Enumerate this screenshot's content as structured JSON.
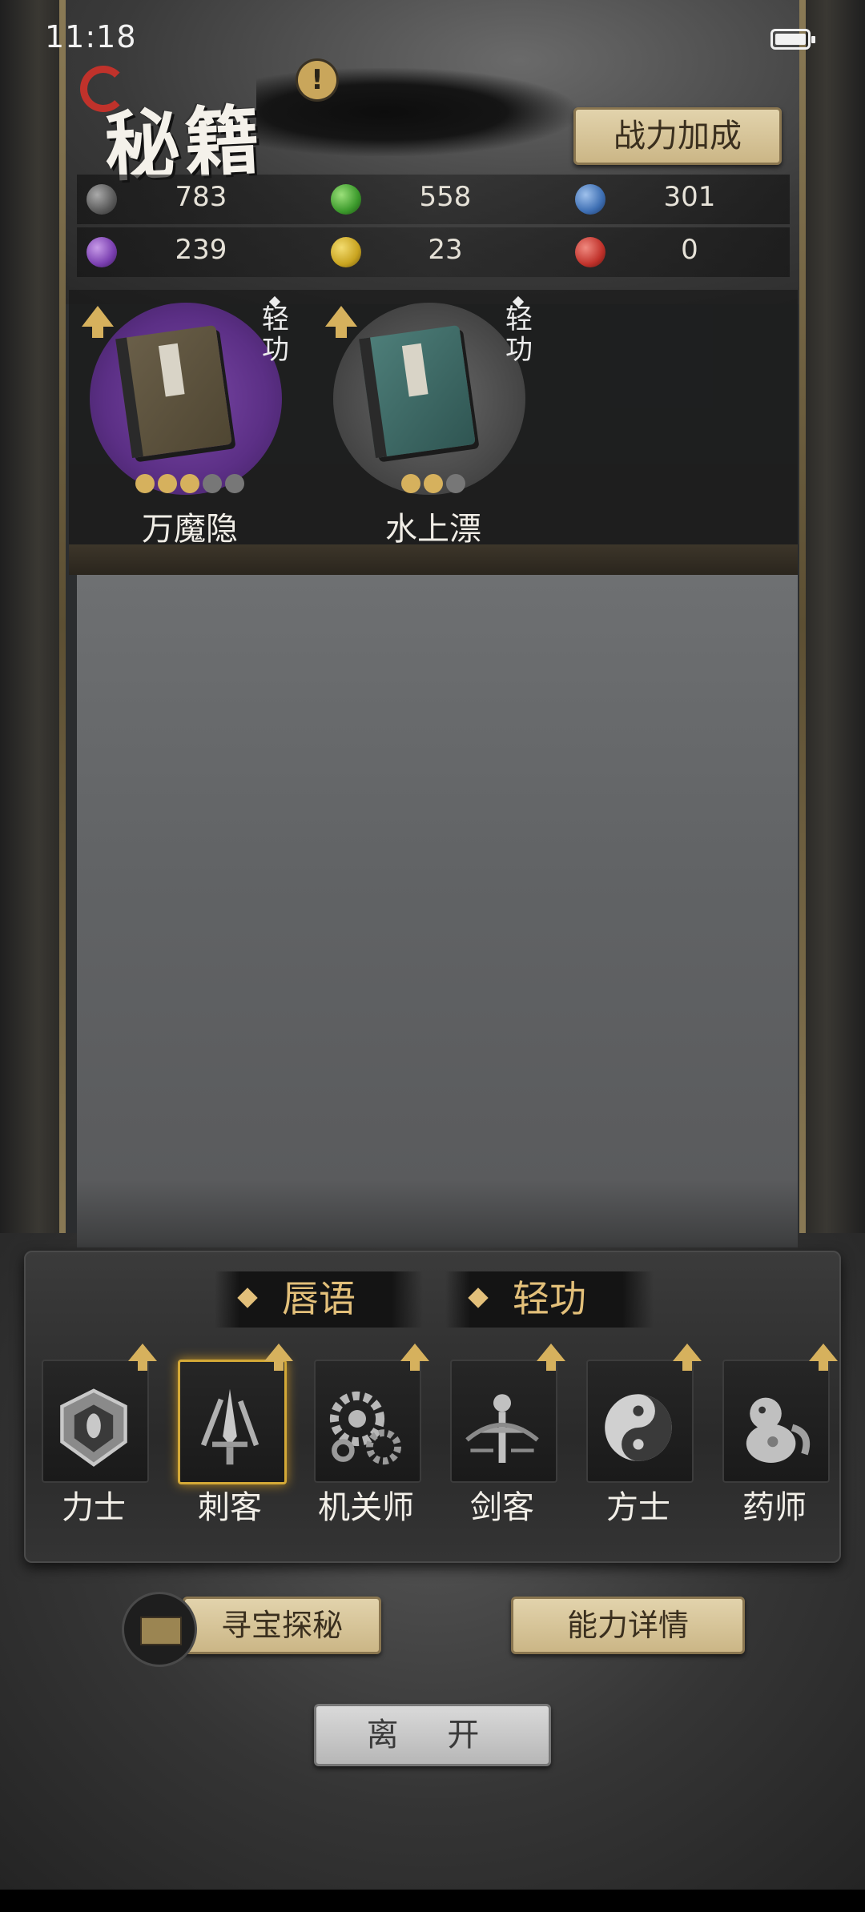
{
  "status_bar": {
    "time": "11:18"
  },
  "header": {
    "title": "秘籍",
    "alert": "!",
    "boost_button": "战力加成"
  },
  "resources": [
    {
      "icon": "gray-orb-icon",
      "color": "#6f6f6f",
      "value": "783"
    },
    {
      "icon": "green-orb-icon",
      "color": "#4aa63a",
      "value": "558"
    },
    {
      "icon": "blue-orb-icon",
      "color": "#3e6fb3",
      "value": "301"
    },
    {
      "icon": "purple-orb-icon",
      "color": "#7a3fb0",
      "value": "239"
    },
    {
      "icon": "yellow-orb-icon",
      "color": "#c9a420",
      "value": "23"
    },
    {
      "icon": "red-orb-icon",
      "color": "#c0322b",
      "value": "0"
    }
  ],
  "books": [
    {
      "name": "万魔隐",
      "type": "轻功",
      "circle_color": "#5b2f85",
      "cover_color": "#5f5540",
      "stars_filled": 3,
      "stars_total": 5
    },
    {
      "name": "水上漂",
      "type": "轻功",
      "circle_color": "#4a4a4a",
      "cover_color": "#3f6a66",
      "stars_filled": 2,
      "stars_total": 3
    }
  ],
  "tabs": [
    {
      "label": "唇语"
    },
    {
      "label": "轻功"
    }
  ],
  "classes": [
    {
      "name": "力士",
      "icon": "shield-helmet-icon",
      "selected": false
    },
    {
      "name": "刺客",
      "icon": "dagger-claw-icon",
      "selected": true
    },
    {
      "name": "机关师",
      "icon": "gears-icon",
      "selected": false
    },
    {
      "name": "剑客",
      "icon": "sword-icon",
      "selected": false
    },
    {
      "name": "方士",
      "icon": "yin-yang-icon",
      "selected": false
    },
    {
      "name": "药师",
      "icon": "gourd-creature-icon",
      "selected": false
    }
  ],
  "footer": {
    "treasure_button": "寻宝探秘",
    "details_button": "能力详情",
    "leave_button": "离 开"
  }
}
